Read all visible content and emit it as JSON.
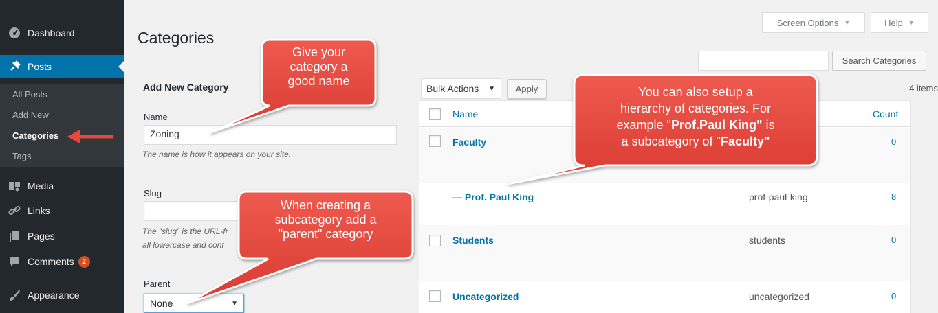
{
  "sidebar": {
    "items": [
      {
        "label": "Dashboard",
        "icon": "dashboard-icon"
      },
      {
        "label": "Posts",
        "icon": "pin-icon"
      },
      {
        "label": "Media",
        "icon": "media-icon"
      },
      {
        "label": "Links",
        "icon": "link-icon"
      },
      {
        "label": "Pages",
        "icon": "pages-icon"
      },
      {
        "label": "Comments",
        "icon": "comment-icon",
        "badge": "2"
      },
      {
        "label": "Appearance",
        "icon": "brush-icon"
      }
    ],
    "submenu": [
      "All Posts",
      "Add New",
      "Categories",
      "Tags"
    ]
  },
  "header": {
    "screen_options": "Screen Options",
    "help": "Help",
    "title": "Categories"
  },
  "form": {
    "heading": "Add New Category",
    "name_label": "Name",
    "name_value": "Zoning",
    "name_hint": "The name is how it appears on your site.",
    "slug_label": "Slug",
    "slug_hint_1": "The “slug” is the URL-fr",
    "slug_hint_2": "all lowercase and cont",
    "parent_label": "Parent",
    "parent_value": "None"
  },
  "list": {
    "search_button": "Search Categories",
    "bulk_actions": "Bulk Actions",
    "apply": "Apply",
    "items_count": "4 items",
    "headers": {
      "name": "Name",
      "count": "Count"
    },
    "rows": [
      {
        "name": "Faculty",
        "slug": "",
        "count": "0"
      },
      {
        "name": "— Prof. Paul King",
        "slug": "prof-paul-king",
        "count": "8"
      },
      {
        "name": "Students",
        "slug": "students",
        "count": "0"
      },
      {
        "name": "Uncategorized",
        "slug": "uncategorized",
        "count": "0"
      }
    ]
  },
  "callouts": {
    "name_tip": [
      "Give your",
      "category a",
      "good name"
    ],
    "parent_tip": [
      "When creating a",
      "subcategory add a",
      "\"parent\" category"
    ],
    "hierarchy_tip": {
      "line1": "You can also setup a",
      "line2": "hierarchy of categories.  For",
      "line3_pre": "example \"",
      "line3_bold": "Prof.Paul King\"",
      "line3_post": " is",
      "line4_pre": "a subcategory of \"",
      "line4_bold": "Faculty\""
    }
  },
  "colors": {
    "sidebar": "#23282d",
    "active": "#0073aa",
    "link": "#0073aa",
    "callout_fill": "#e8473d",
    "arrow": "#e8473d"
  }
}
